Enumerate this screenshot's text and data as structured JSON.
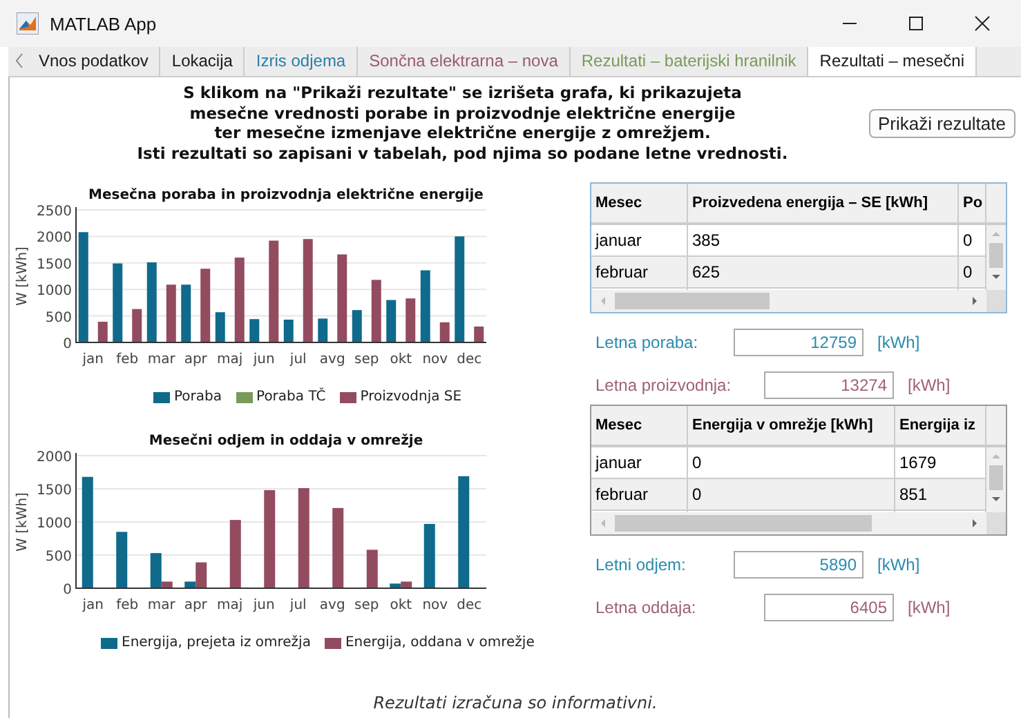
{
  "window": {
    "title": "MATLAB App"
  },
  "tabs": [
    {
      "label": "Vnos podatkov",
      "selected": false,
      "color": "#1a1a1a"
    },
    {
      "label": "Lokacija",
      "selected": false,
      "color": "#1a1a1a"
    },
    {
      "label": "Izris odjema",
      "selected": false,
      "color": "#2a7fa8"
    },
    {
      "label": "Sončna elektrarna – nova",
      "selected": false,
      "color": "#9a5a70"
    },
    {
      "label": "Rezultati – baterijski hranilnik",
      "selected": false,
      "color": "#7a9a5a"
    },
    {
      "label": "Rezultati – mesečni",
      "selected": true,
      "color": "#1a1a1a"
    }
  ],
  "intro": [
    "S klikom na \"Prikaži rezultate\" se izrišeta grafa, ki prikazujeta",
    "mesečne vrednosti porabe in proizvodnje električne energije",
    "ter mesečne izmenjave električne energije z omrežjem.",
    "Isti rezultati so zapisani v tabelah, pod njima so podane letne vrednosti."
  ],
  "show_button": "Prikaži rezultate",
  "charts": [
    {
      "chart_data": {
        "type": "bar",
        "title": "Mesečna poraba in proizvodnja električne energije",
        "ylabel": "W  [kWh]",
        "categories": [
          "jan",
          "feb",
          "mar",
          "apr",
          "maj",
          "jun",
          "jul",
          "avg",
          "sep",
          "okt",
          "nov",
          "dec"
        ],
        "ylim": [
          0,
          2500
        ],
        "yticks": [
          0,
          500,
          1000,
          1500,
          2000,
          2500
        ],
        "grid": true,
        "legend": "bottom",
        "series": [
          {
            "name": "Poraba",
            "color": "#0f6a8c",
            "values": [
              2080,
              1490,
              1510,
              1090,
              570,
              440,
              430,
              450,
              610,
              800,
              1360,
              2000
            ]
          },
          {
            "name": "Poraba TČ",
            "color": "#7a9a5a",
            "values": [
              0,
              0,
              0,
              0,
              0,
              0,
              0,
              0,
              0,
              0,
              0,
              0
            ]
          },
          {
            "name": "Proizvodnja SE",
            "color": "#934b5f",
            "values": [
              390,
              630,
              1090,
              1390,
              1600,
              1920,
              1950,
              1660,
              1180,
              830,
              380,
              300
            ]
          }
        ]
      }
    },
    {
      "chart_data": {
        "type": "bar",
        "title": "Mesečni odjem in oddaja v omrežje",
        "ylabel": "W  [kWh]",
        "categories": [
          "jan",
          "feb",
          "mar",
          "apr",
          "maj",
          "jun",
          "jul",
          "avg",
          "sep",
          "okt",
          "nov",
          "dec"
        ],
        "ylim": [
          0,
          2000
        ],
        "yticks": [
          0,
          500,
          1000,
          1500,
          2000
        ],
        "grid": true,
        "legend": "bottom",
        "series": [
          {
            "name": "Energija, prejeta iz omrežja",
            "color": "#0f6a8c",
            "values": [
              1680,
              850,
              530,
              100,
              0,
              0,
              0,
              0,
              0,
              70,
              970,
              1690
            ]
          },
          {
            "name": "Energija, oddana v omrežje",
            "color": "#934b5f",
            "values": [
              0,
              0,
              100,
              390,
              1030,
              1480,
              1510,
              1210,
              580,
              100,
              0,
              0
            ]
          }
        ]
      }
    }
  ],
  "tables": [
    {
      "columns": [
        "Mesec",
        "Proizvedena energija – SE [kWh]",
        "Po"
      ],
      "rows": [
        [
          "januar",
          "385",
          "0"
        ],
        [
          "februar",
          "625",
          "0"
        ]
      ],
      "summary": [
        {
          "label": "Letna poraba:",
          "value": "12759",
          "unit": "[kWh]",
          "color": "#2a8bb0"
        },
        {
          "label": "Letna proizvodnja:",
          "value": "13274",
          "unit": "[kWh]",
          "color": "#a0607a"
        }
      ]
    },
    {
      "columns": [
        "Mesec",
        "Energija v omrežje [kWh]",
        "Energija iz"
      ],
      "rows": [
        [
          "januar",
          "0",
          "1679"
        ],
        [
          "februar",
          "0",
          "851"
        ]
      ],
      "summary": [
        {
          "label": "Letni odjem:",
          "value": "5890",
          "unit": "[kWh]",
          "color": "#2a8bb0"
        },
        {
          "label": "Letna oddaja:",
          "value": "6405",
          "unit": "[kWh]",
          "color": "#a0607a"
        }
      ]
    }
  ],
  "footer": "Rezultati izračuna so informativni."
}
